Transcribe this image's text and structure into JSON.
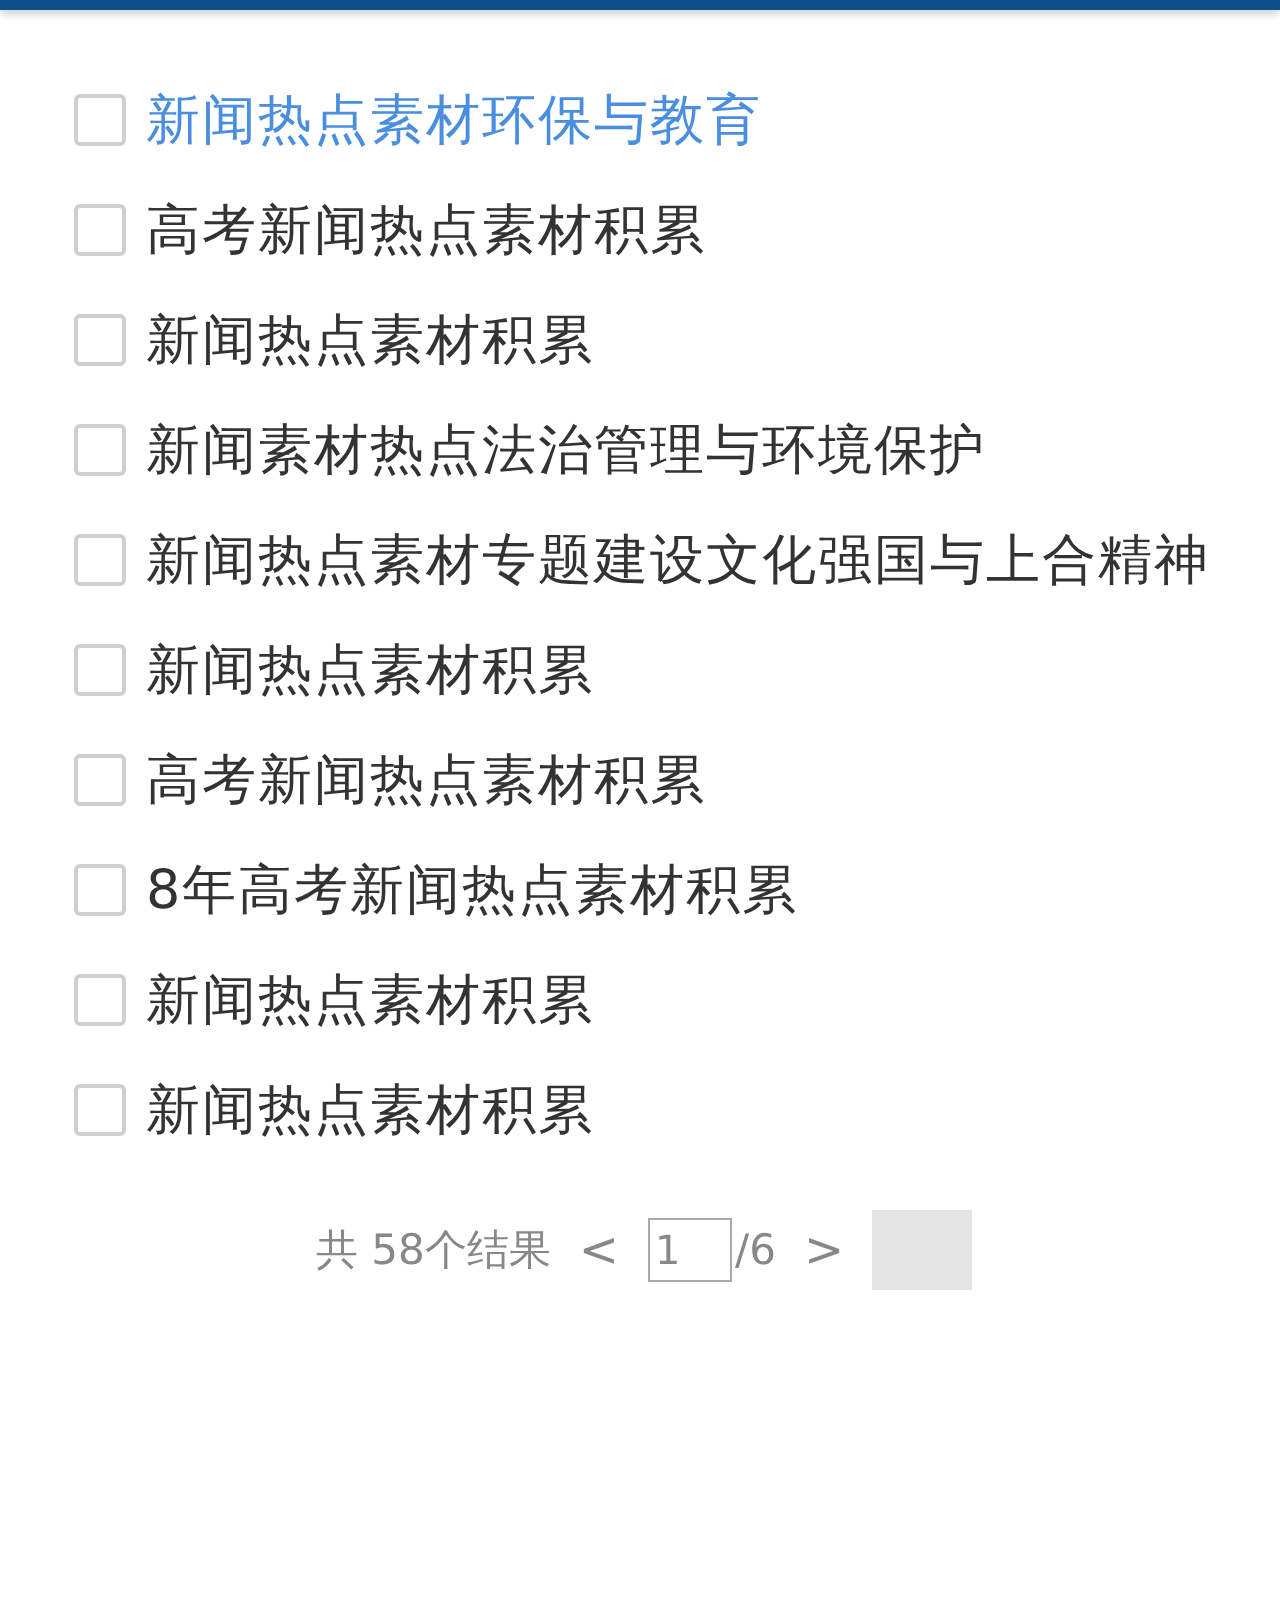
{
  "items": [
    {
      "label": "新闻热点素材环保与教育",
      "checked": false,
      "selected": true
    },
    {
      "label": "高考新闻热点素材积累",
      "checked": false,
      "selected": false
    },
    {
      "label": "新闻热点素材积累",
      "checked": false,
      "selected": false
    },
    {
      "label": "新闻素材热点法治管理与环境保护",
      "checked": false,
      "selected": false
    },
    {
      "label": "新闻热点素材专题建设文化强国与上合精神",
      "checked": false,
      "selected": false
    },
    {
      "label": "新闻热点素材积累",
      "checked": false,
      "selected": false
    },
    {
      "label": "高考新闻热点素材积累",
      "checked": false,
      "selected": false
    },
    {
      "label": "8年高考新闻热点素材积累",
      "checked": false,
      "selected": false
    },
    {
      "label": "新闻热点素材积累",
      "checked": false,
      "selected": false
    },
    {
      "label": "新闻热点素材积累",
      "checked": false,
      "selected": false
    }
  ],
  "pagination": {
    "total": "共 58个结果",
    "prev": "<",
    "page": "1",
    "pages": "/6",
    "next": ">"
  }
}
